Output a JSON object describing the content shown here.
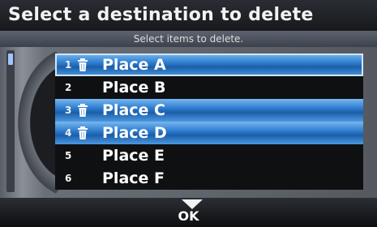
{
  "header": {
    "title": "Select a destination to delete",
    "subtitle": "Select items to delete."
  },
  "list": {
    "items": [
      {
        "number": "1",
        "label": "Place A",
        "selected": true
      },
      {
        "number": "2",
        "label": "Place B",
        "selected": false
      },
      {
        "number": "3",
        "label": "Place C",
        "selected": true
      },
      {
        "number": "4",
        "label": "Place D",
        "selected": true
      },
      {
        "number": "5",
        "label": "Place E",
        "selected": false
      },
      {
        "number": "6",
        "label": "Place F",
        "selected": false
      }
    ]
  },
  "footer": {
    "ok_label": "OK"
  },
  "colors": {
    "selected_row": "#2f7ed0",
    "background": "#0a0a0a",
    "text": "#ffffff"
  },
  "icons": {
    "selected_marker": "trash-icon",
    "ok_marker": "down-arrow-icon"
  }
}
